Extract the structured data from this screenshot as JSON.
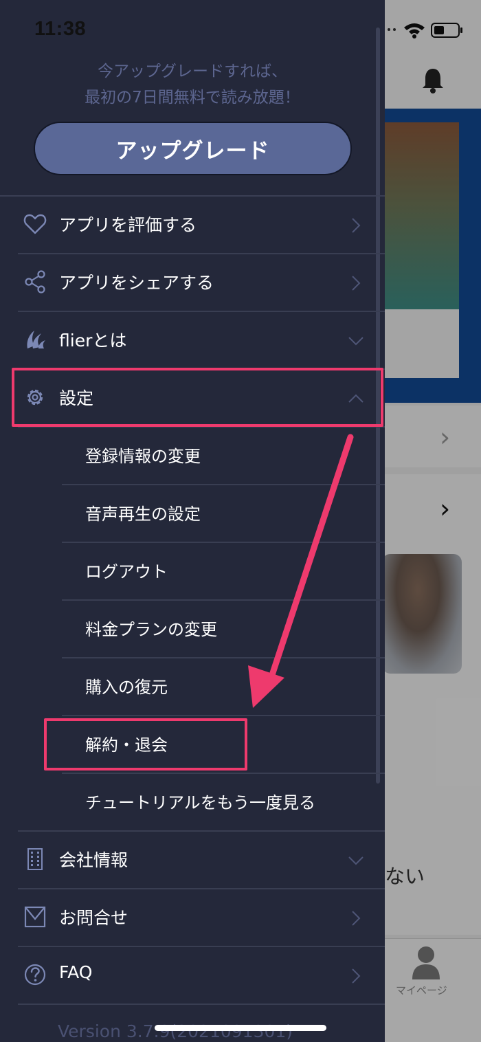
{
  "status_bar": {
    "time": "11:38"
  },
  "drawer": {
    "promo_line1": "今アップグレードすれば、",
    "promo_line2": "最初の7日間無料で読み放題！",
    "upgrade_button": "アップグレード",
    "menu": [
      {
        "label": "アプリを評価する",
        "icon": "heart-icon",
        "arrow": "chevron-right"
      },
      {
        "label": "アプリをシェアする",
        "icon": "share-icon",
        "arrow": "chevron-right"
      },
      {
        "label": "flierとは",
        "icon": "flier-logo-icon",
        "arrow": "chevron-down"
      },
      {
        "label": "設定",
        "icon": "gear-icon",
        "arrow": "chevron-up"
      }
    ],
    "settings_submenu": [
      "登録情報の変更",
      "音声再生の設定",
      "ログアウト",
      "料金プランの変更",
      "購入の復元",
      "解約・退会",
      "チュートリアルをもう一度見る"
    ],
    "menu_bottom": [
      {
        "label": "会社情報",
        "icon": "building-icon",
        "arrow": "chevron-down"
      },
      {
        "label": "お問合せ",
        "icon": "mail-icon",
        "arrow": "chevron-right"
      },
      {
        "label": "FAQ",
        "icon": "help-icon",
        "arrow": "chevron-right"
      }
    ],
    "version": "Version  3.7.9(2021091301)"
  },
  "background_app": {
    "partial_text": "ない",
    "tab_mypage": "マイページ"
  },
  "annotation": {
    "color": "#ee3a6d"
  },
  "colors": {
    "drawer_bg": "#24283a",
    "upgrade_button": "#5a6897",
    "promo_text": "#5d6690"
  }
}
